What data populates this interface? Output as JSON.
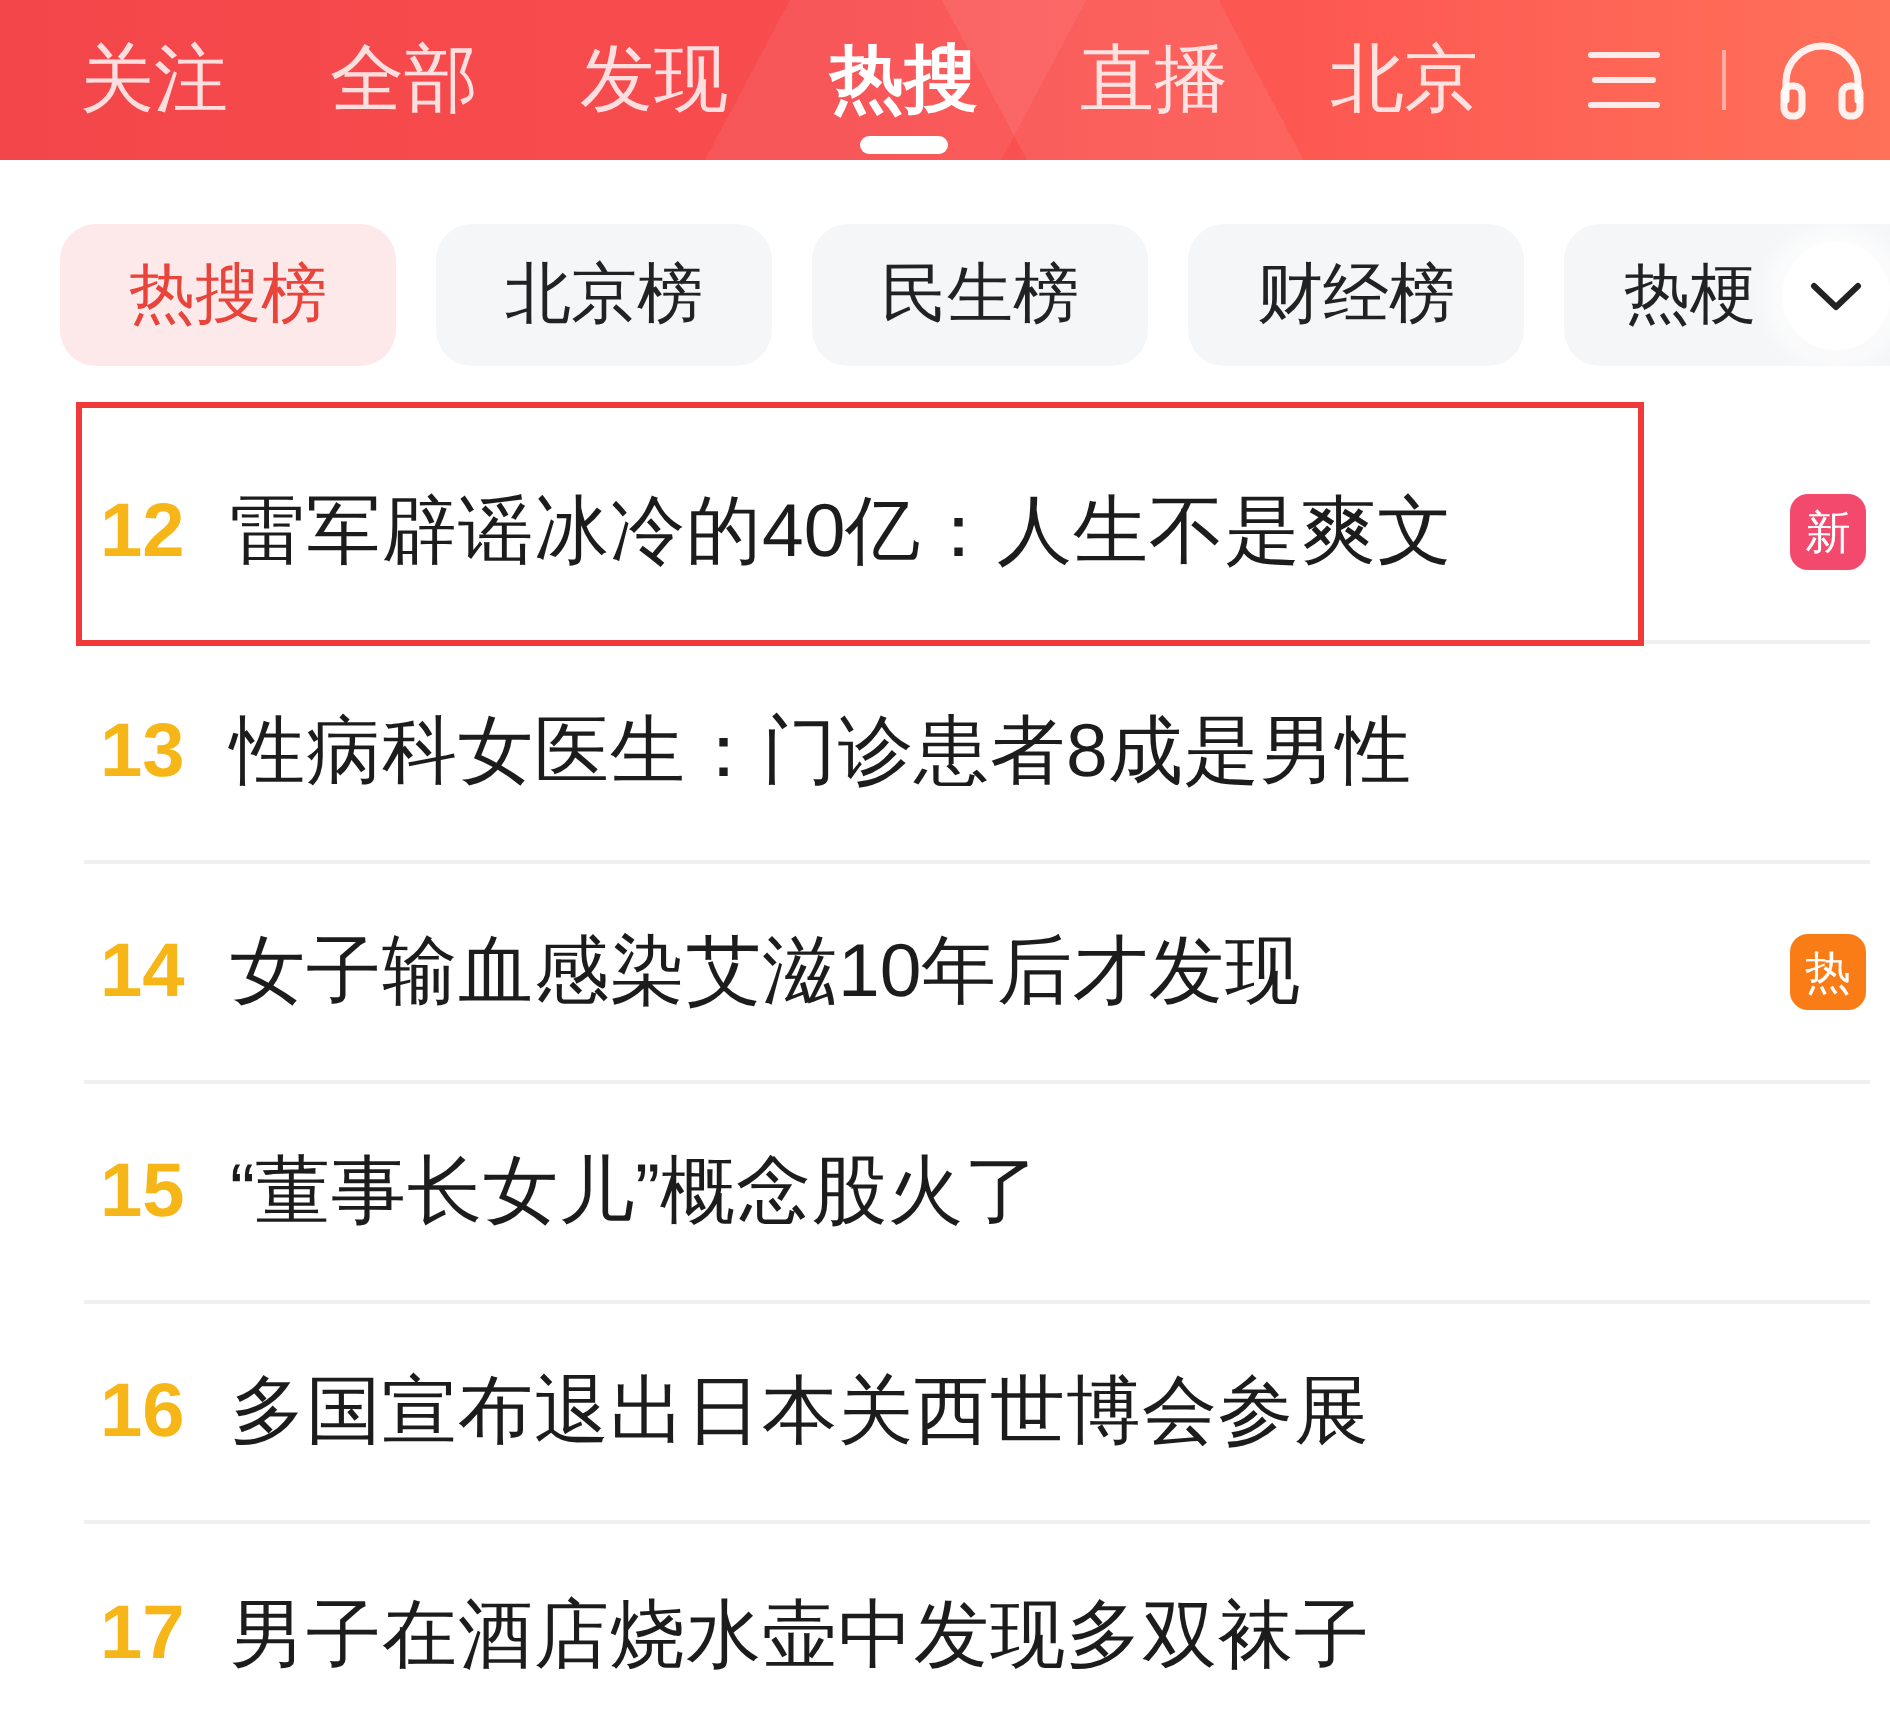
{
  "top_tabs": [
    {
      "label": "关注",
      "selected": false
    },
    {
      "label": "全部",
      "selected": false
    },
    {
      "label": "发现",
      "selected": false
    },
    {
      "label": "热搜",
      "selected": true
    },
    {
      "label": "直播",
      "selected": false
    },
    {
      "label": "北京",
      "selected": false
    }
  ],
  "board_chips": [
    {
      "label": "热搜榜",
      "selected": true
    },
    {
      "label": "北京榜",
      "selected": false
    },
    {
      "label": "民生榜",
      "selected": false
    },
    {
      "label": "财经榜",
      "selected": false
    },
    {
      "label": "热梗",
      "selected": false
    }
  ],
  "hot_list": [
    {
      "rank": "12",
      "title": "雷军辟谣冰冷的40亿：人生不是爽文",
      "highlighted": true,
      "badge": {
        "kind": "new",
        "label": "新"
      }
    },
    {
      "rank": "13",
      "title": "性病科女医生：门诊患者8成是男性",
      "highlighted": false
    },
    {
      "rank": "14",
      "title": "女子输血感染艾滋10年后才发现",
      "highlighted": false,
      "badge": {
        "kind": "hot",
        "label": "热"
      }
    },
    {
      "rank": "15",
      "title": "“董事长女儿”概念股火了",
      "highlighted": false
    },
    {
      "rank": "16",
      "title": "多国宣布退出日本关西世博会参展",
      "highlighted": false
    },
    {
      "rank": "17",
      "title": "男子在酒店烧水壶中发现多双袜子",
      "highlighted": false
    }
  ]
}
